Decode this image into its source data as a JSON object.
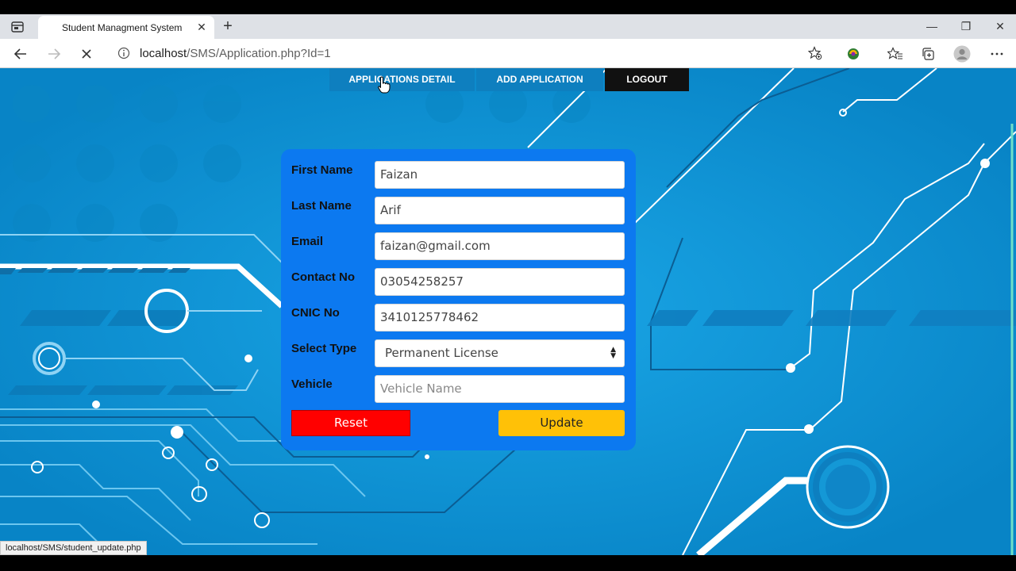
{
  "browser": {
    "tab_title": "Student Managment System",
    "tab_close": "✕",
    "new_tab": "+",
    "url_host": "localhost",
    "url_path": "/SMS/Application.php?Id=1",
    "window_controls": {
      "minimize": "—",
      "restore": "❐",
      "close": "✕"
    },
    "status_url": "localhost/SMS/student_update.php"
  },
  "nav": {
    "items": [
      {
        "label": "APPLICATIONS DETAIL"
      },
      {
        "label": "ADD APPLICATION"
      },
      {
        "label": "LOGOUT"
      }
    ]
  },
  "form": {
    "fields": [
      {
        "label": "First Name",
        "value": "Faizan"
      },
      {
        "label": "Last Name",
        "value": "Arif"
      },
      {
        "label": "Email",
        "value": "faizan@gmail.com"
      },
      {
        "label": "Contact No",
        "value": "03054258257"
      },
      {
        "label": "CNIC No",
        "value": "3410125778462"
      },
      {
        "label": "Select Type",
        "value": "Permanent License"
      },
      {
        "label": "Vehicle",
        "placeholder": "Vehicle Name"
      }
    ],
    "reset_label": "Reset",
    "update_label": "Update"
  },
  "colors": {
    "page_bg": "#0b95d8",
    "form_bg": "#0c79f0",
    "reset": "#ff0000",
    "update": "#ffc107",
    "nav_bg": "#0e7fbf",
    "logout_bg": "#111111"
  },
  "icons": [
    "tab-actions-icon",
    "back-arrow-icon",
    "forward-arrow-icon",
    "stop-loading-icon",
    "info-icon",
    "favorite-add-icon",
    "extension-icon",
    "favorites-icon",
    "collections-icon",
    "profile-icon",
    "more-icon"
  ]
}
